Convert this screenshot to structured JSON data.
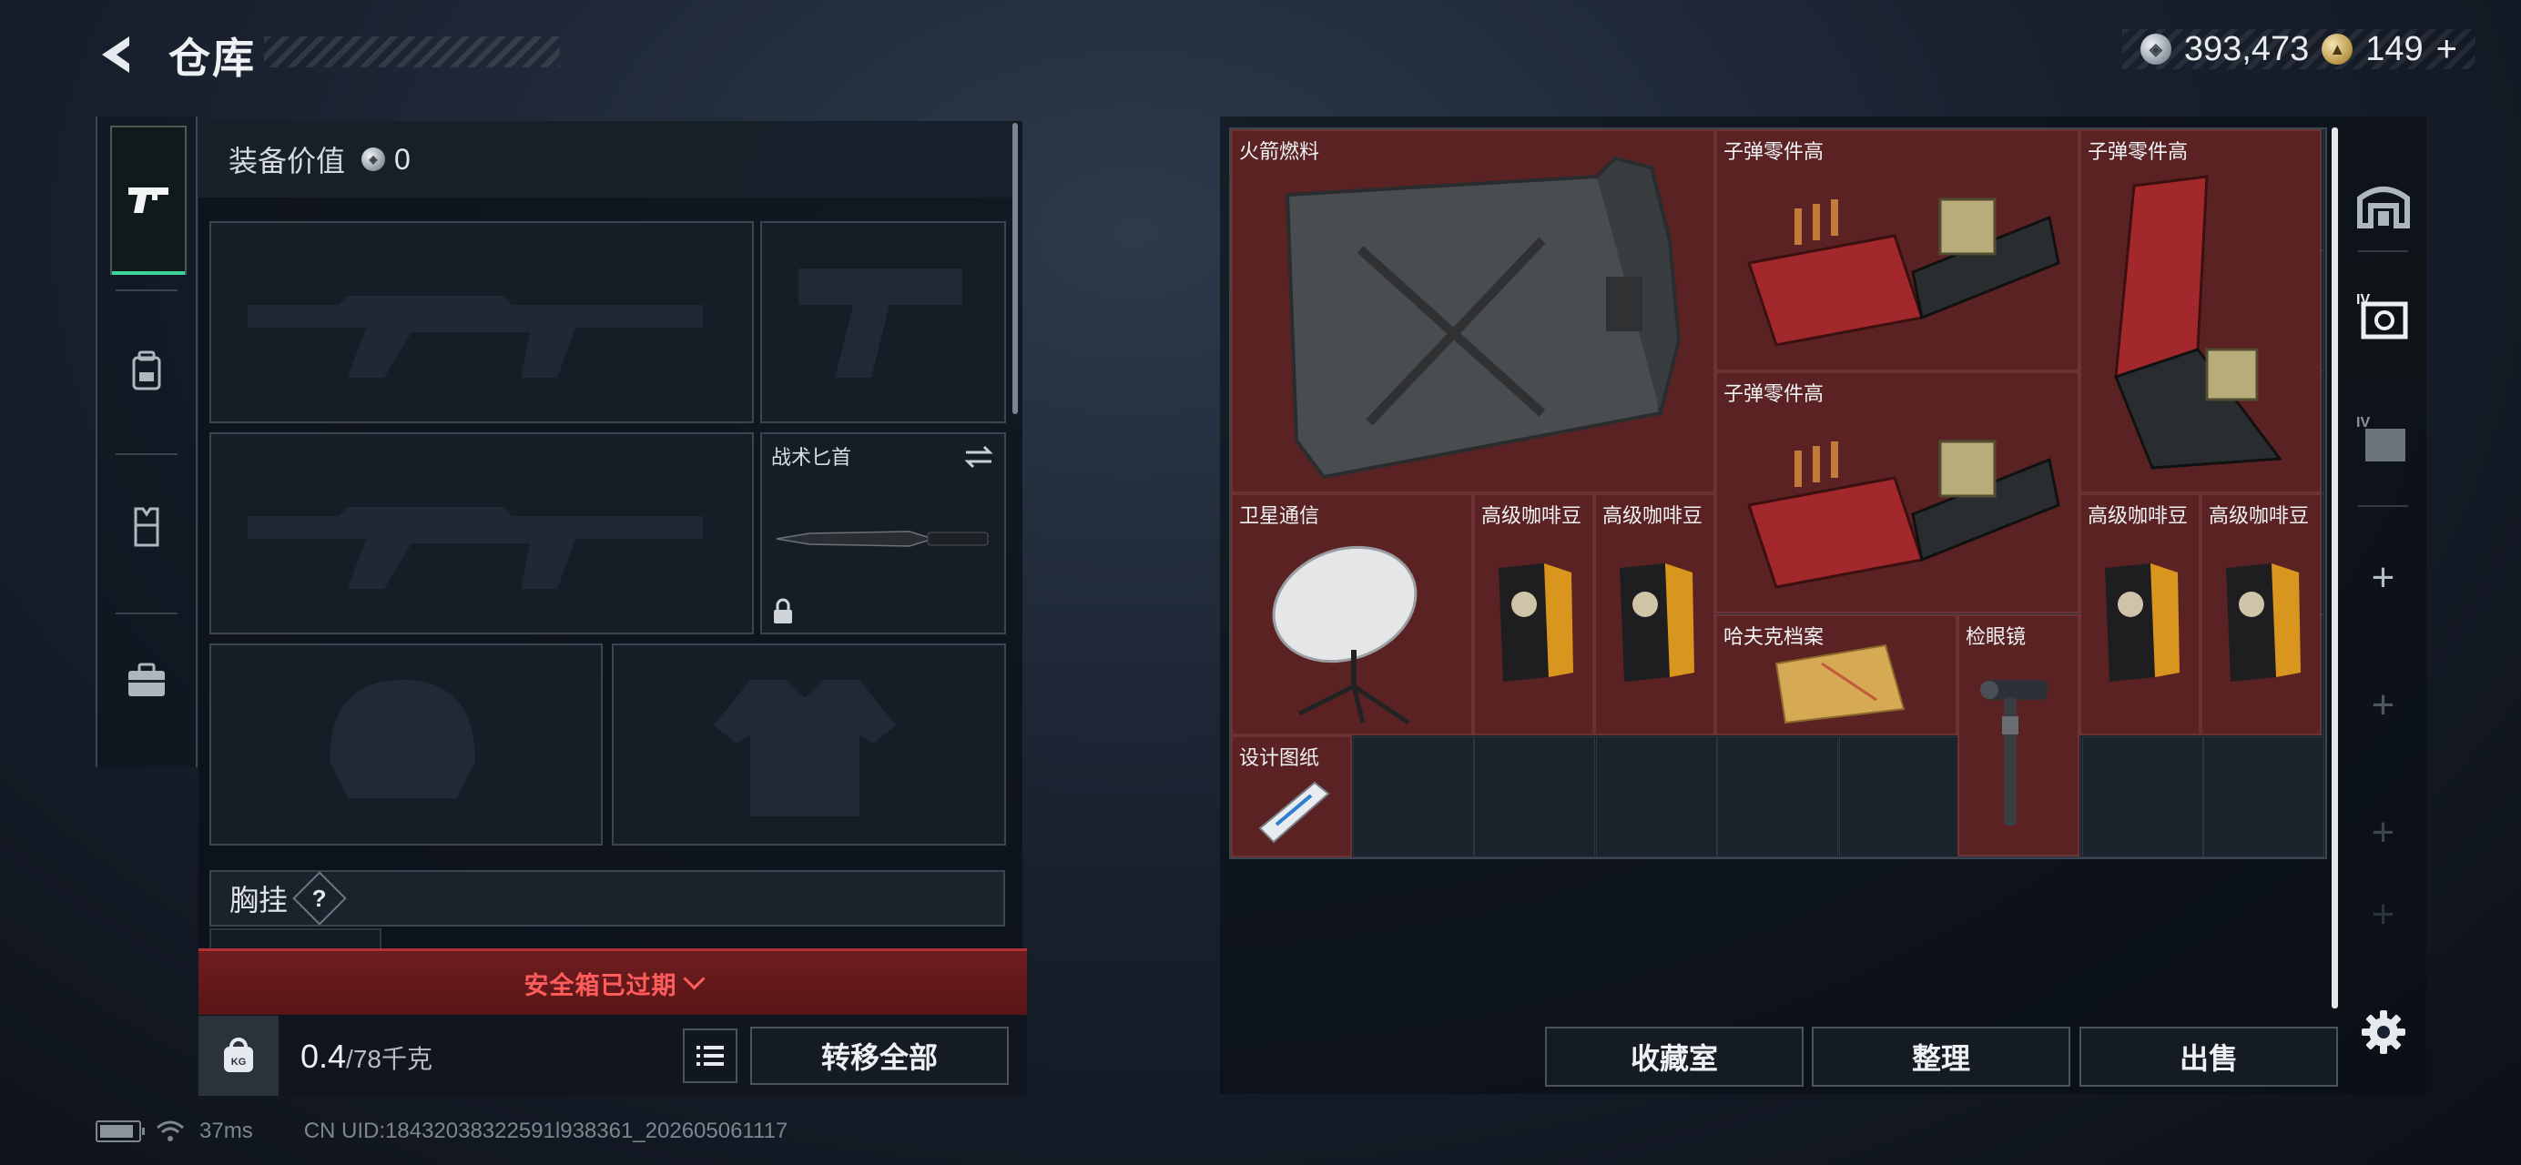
{
  "header": {
    "title": "仓库"
  },
  "currency": {
    "silver": "393,473",
    "gold": "149",
    "add_label": "+"
  },
  "equipment": {
    "value_label": "装备价值",
    "value": "0",
    "slots": {
      "melee_name": "战术匕首"
    },
    "chest_rig_label": "胸挂",
    "chest_rig_help": "?"
  },
  "safe_box": {
    "status": "安全箱已过期"
  },
  "carry": {
    "current": "0.4",
    "capacity": "/78千克",
    "kg_icon_text": "KG"
  },
  "buttons": {
    "transfer_all": "转移全部",
    "collection": "收藏室",
    "organize": "整理",
    "sell": "出售"
  },
  "status_bar": {
    "ping": "37ms",
    "uid": "CN UID:18432038322591l938361_202605061117"
  },
  "storage": {
    "items": [
      {
        "name": "火箭燃料",
        "icon": "jerrycan-icon"
      },
      {
        "name": "子弹零件高",
        "icon": "ammo-crate-icon"
      },
      {
        "name": "子弹零件高",
        "icon": "ammo-crate-icon"
      },
      {
        "name": "子弹零件高",
        "icon": "ammo-crate-icon"
      },
      {
        "name": "卫星通信",
        "icon": "satellite-dish-icon"
      },
      {
        "name": "高级咖啡豆",
        "icon": "coffee-bag-icon"
      },
      {
        "name": "高级咖啡豆",
        "icon": "coffee-bag-icon"
      },
      {
        "name": "高级咖啡豆",
        "icon": "coffee-bag-icon"
      },
      {
        "name": "高级咖啡豆",
        "icon": "coffee-bag-icon"
      },
      {
        "name": "哈夫克档案",
        "icon": "document-icon"
      },
      {
        "name": "检眼镜",
        "icon": "ophthalmoscope-icon"
      },
      {
        "name": "设计图纸",
        "icon": "blueprint-icon"
      }
    ]
  },
  "side_tabs": {
    "tab2_tier": "IV",
    "tab3_tier": "IV",
    "add_label": "+"
  },
  "colors": {
    "item_bg": "#5b2224",
    "accent_green": "#3fd39a",
    "warning_red": "#ff5c5c"
  }
}
